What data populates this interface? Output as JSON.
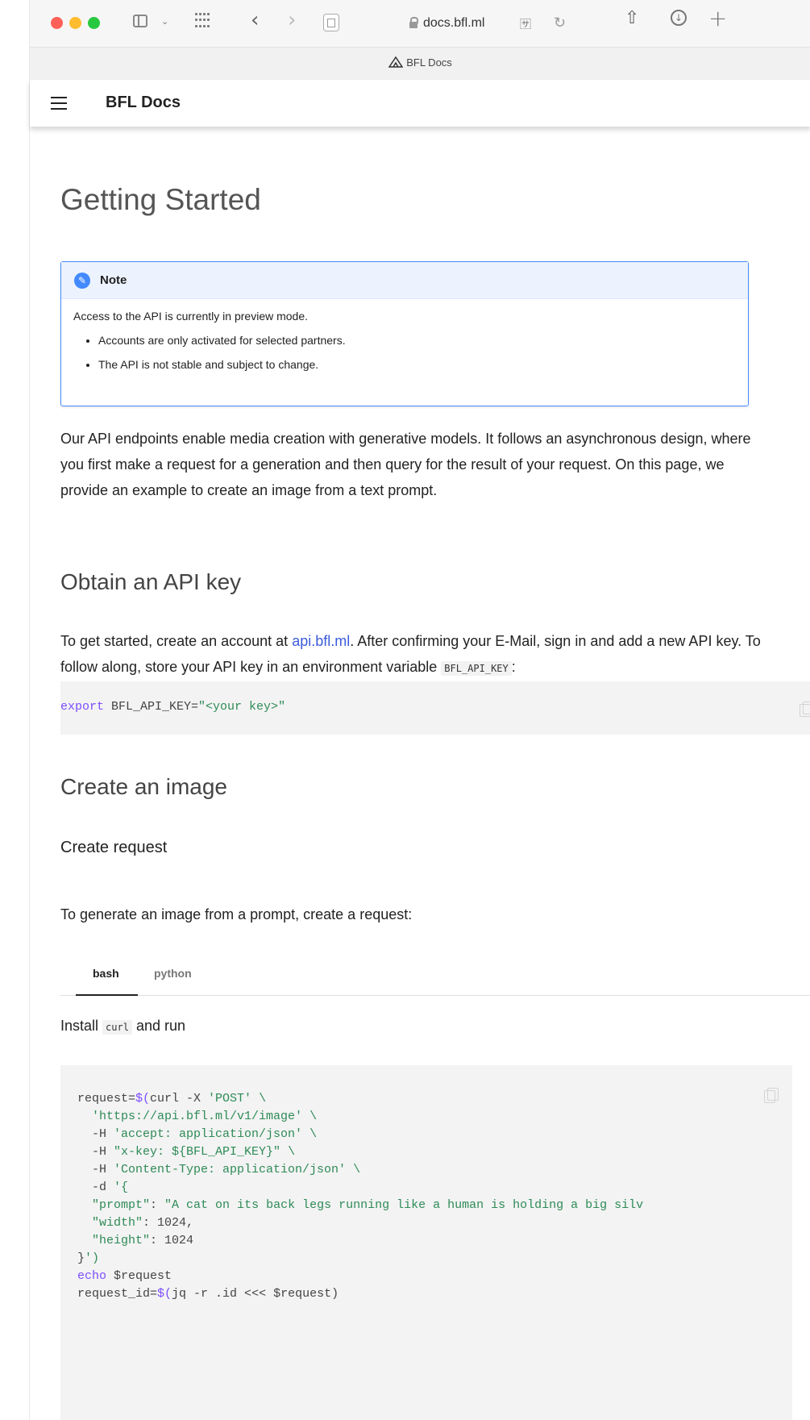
{
  "browser": {
    "url": "docs.bfl.ml",
    "tab_title": "BFL Docs",
    "translate_label": "🈂"
  },
  "site": {
    "title": "BFL Docs"
  },
  "page": {
    "title": "Getting Started",
    "note": {
      "title": "Note",
      "body": "Access to the API is currently in preview mode.",
      "bullets": [
        "Accounts are only activated for selected partners.",
        "The API is not stable and subject to change."
      ]
    },
    "intro": "Our API endpoints enable media creation with generative models. It follows an asynchronous design, where you first make a request for a generation and then query for the result of your request. On this page, we provide an example to create an image from a text prompt.",
    "section_api_key": {
      "heading": "Obtain an API key",
      "text_before_link": "To get started, create an account at ",
      "link_text": "api.bfl.ml",
      "text_after_link": ". After confirming your E-Mail, sign in and add a new API key. To follow along, store your API key in an environment variable ",
      "inline_code": "BFL_API_KEY",
      "text_end": ":",
      "code": {
        "kw": "export",
        "var": " BFL_API_KEY=",
        "str": "\"<your key>\""
      }
    },
    "section_create_image": {
      "heading": "Create an image",
      "subheading": "Create request",
      "text": "To generate an image from a prompt, create a request:",
      "tabs": [
        "bash",
        "python"
      ],
      "install_text_before": "Install ",
      "install_code": "curl",
      "install_text_after": " and run",
      "code_lines": [
        "request=$(curl -X 'POST' \\",
        "  'https://api.bfl.ml/v1/image' \\",
        "  -H 'accept: application/json' \\",
        "  -H \"x-key: ${BFL_API_KEY}\" \\",
        "  -H 'Content-Type: application/json' \\",
        "  -d '{",
        "  \"prompt\": \"A cat on its back legs running like a human is holding a big silv",
        "  \"width\": 1024,",
        "  \"height\": 1024",
        "}')",
        "echo $request",
        "request_id=$(jq -r .id <<< $request)"
      ]
    }
  },
  "colors": {
    "note_accent": "#448aff",
    "link": "#3b5bdb",
    "keyword": "#7c4dff",
    "string": "#2e8b57"
  },
  "icons": [
    "sidebar-icon",
    "tab-grid-icon",
    "back-icon",
    "forward-icon",
    "page-icon",
    "lock-icon",
    "translate-icon",
    "reload-icon",
    "share-icon",
    "download-icon",
    "new-tab-icon",
    "hamburger-menu-icon",
    "info-icon",
    "copy-icon"
  ]
}
